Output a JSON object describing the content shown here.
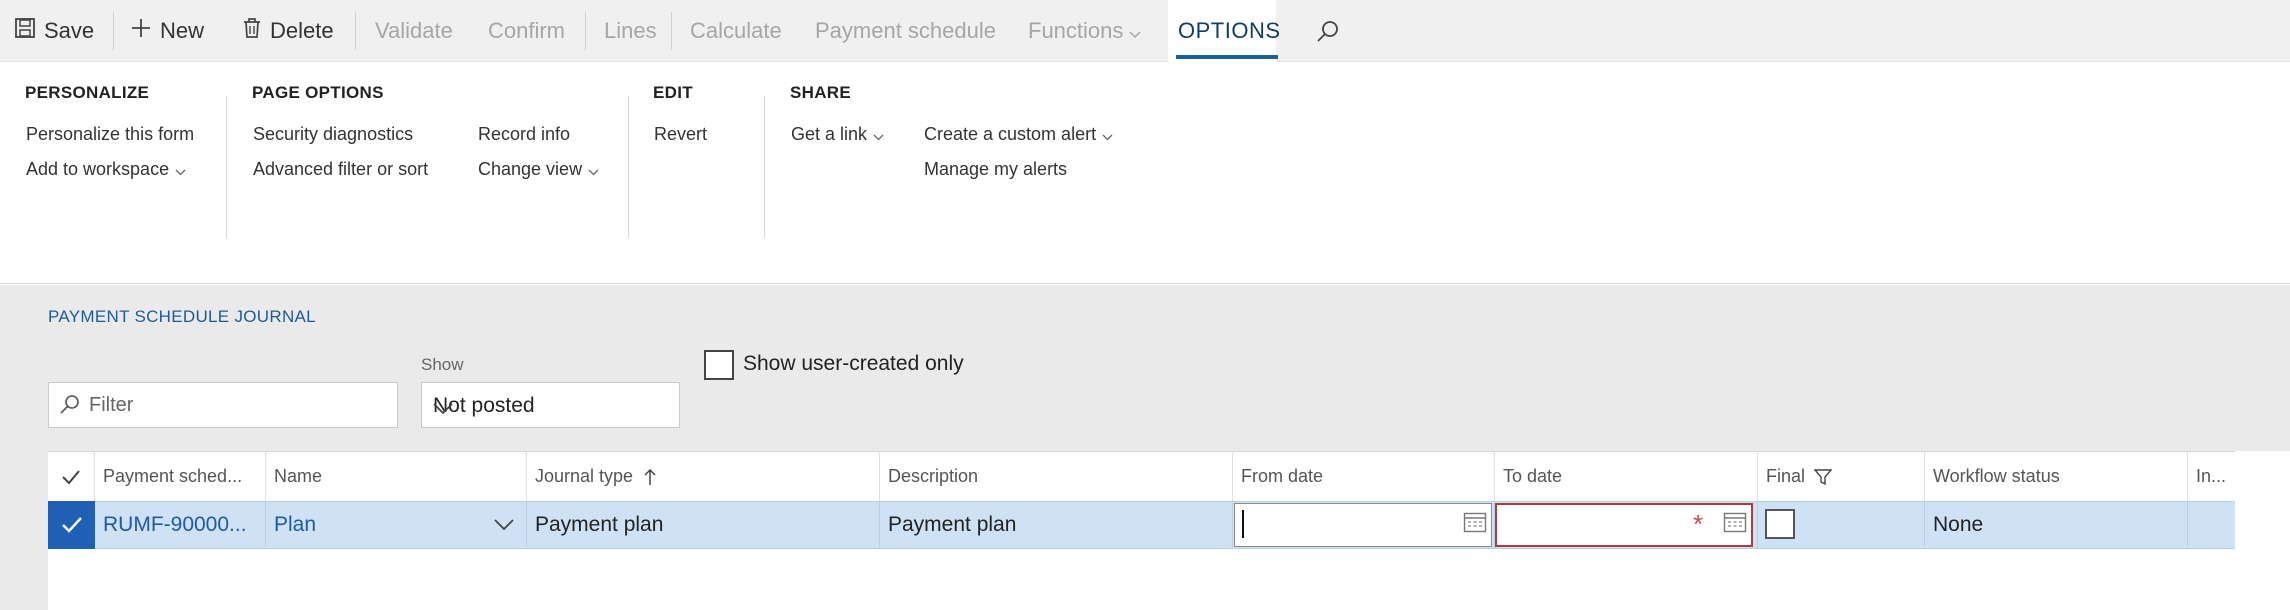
{
  "action_pane": {
    "save": "Save",
    "new": "New",
    "delete": "Delete",
    "validate": "Validate",
    "confirm": "Confirm",
    "lines": "Lines",
    "calculate": "Calculate",
    "payment_schedule": "Payment schedule",
    "functions": "Functions",
    "options_tab": "OPTIONS",
    "search_icon": "search-icon"
  },
  "ribbon": {
    "personalize": {
      "title": "PERSONALIZE",
      "personalize_form": "Personalize this form",
      "add_to_workspace": "Add to workspace"
    },
    "page_options": {
      "title": "PAGE OPTIONS",
      "security_diagnostics": "Security diagnostics",
      "advanced_filter": "Advanced filter or sort",
      "record_info": "Record info",
      "change_view": "Change view"
    },
    "edit": {
      "title": "EDIT",
      "revert": "Revert"
    },
    "share": {
      "title": "SHARE",
      "get_link": "Get a link",
      "create_alert": "Create a custom alert",
      "manage_alerts": "Manage my alerts"
    }
  },
  "form": {
    "caption": "PAYMENT SCHEDULE JOURNAL",
    "filter_placeholder": "Filter",
    "show_label": "Show",
    "show_value": "Not posted",
    "show_user_created": "Show user-created only"
  },
  "grid": {
    "headers": {
      "payment_schedule": "Payment sched...",
      "name": "Name",
      "journal_type": "Journal type",
      "description": "Description",
      "from_date": "From date",
      "to_date": "To date",
      "final": "Final",
      "workflow_status": "Workflow status",
      "in": "In..."
    },
    "rows": [
      {
        "payment_schedule": "RUMF-90000...",
        "name": "Plan",
        "journal_type": "Payment plan",
        "description": "Payment plan",
        "from_date": "",
        "to_date": "",
        "final": false,
        "workflow_status": "None",
        "in": ""
      }
    ],
    "required_marker": "*"
  },
  "colors": {
    "accent": "#1a5fa0",
    "selected_row": "#cfe1f4",
    "row_select": "#1f5fb4",
    "link": "#1f5aa8",
    "required": "#c84b4b"
  }
}
